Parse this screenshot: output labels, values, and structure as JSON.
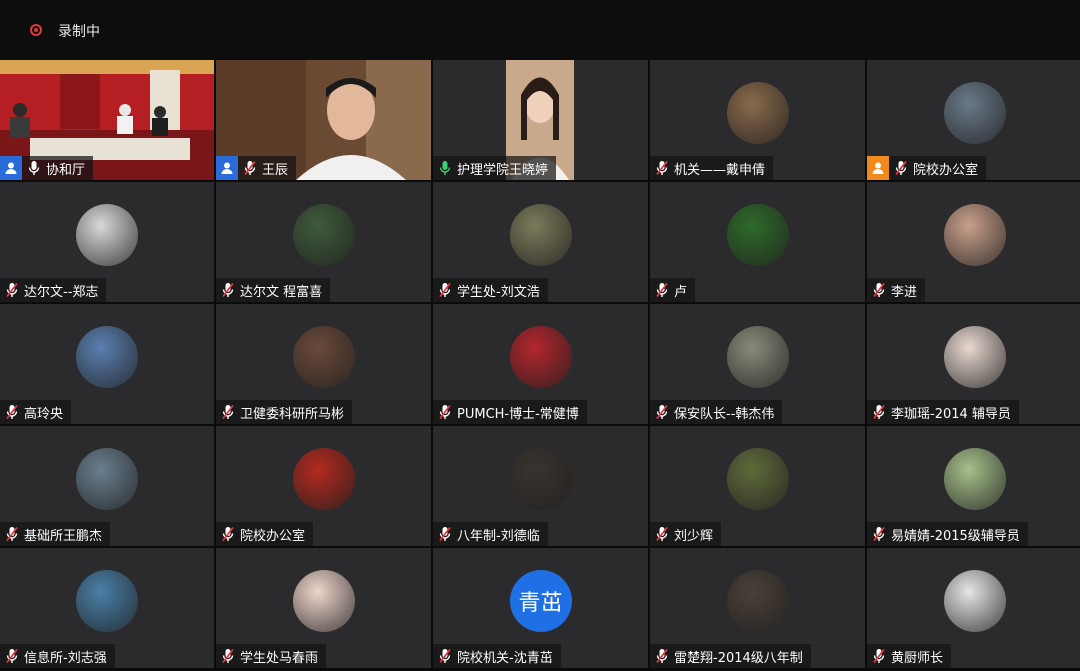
{
  "topbar": {
    "recording_label": "录制中"
  },
  "tiles": [
    {
      "name": "协和厅",
      "badge": "blue",
      "mic": "on",
      "kind": "video",
      "scene": "room"
    },
    {
      "name": "王辰",
      "badge": "blue",
      "mic": "muted",
      "kind": "video",
      "scene": "man"
    },
    {
      "name": "护理学院王晓婷",
      "badge": "",
      "mic": "active",
      "kind": "video",
      "scene": "girl",
      "active": true
    },
    {
      "name": "机关——戴申倩",
      "badge": "",
      "mic": "muted",
      "kind": "avatar",
      "color": "#8a6a4a"
    },
    {
      "name": "院校办公室",
      "badge": "orange",
      "mic": "muted",
      "kind": "avatar",
      "color": "#6a7a8a"
    },
    {
      "name": "达尔文--郑志",
      "badge": "",
      "mic": "muted",
      "kind": "avatar",
      "color": "#d9d9d9"
    },
    {
      "name": "达尔文  程富喜",
      "badge": "",
      "mic": "muted",
      "kind": "avatar",
      "color": "#3f5b3b"
    },
    {
      "name": "学生处-刘文浩",
      "badge": "",
      "mic": "muted",
      "kind": "avatar",
      "color": "#7c7a5a"
    },
    {
      "name": "卢",
      "badge": "",
      "mic": "muted",
      "kind": "avatar",
      "color": "#2f6b2a"
    },
    {
      "name": "李进",
      "badge": "",
      "mic": "muted",
      "kind": "avatar",
      "color": "#c9a08a"
    },
    {
      "name": "高玲央",
      "badge": "",
      "mic": "muted",
      "kind": "avatar",
      "color": "#5a7fb0"
    },
    {
      "name": "卫健委科研所马彬",
      "badge": "",
      "mic": "muted",
      "kind": "avatar",
      "color": "#6b4a3a"
    },
    {
      "name": "PUMCH-博士-常健博",
      "badge": "",
      "mic": "muted",
      "kind": "avatar",
      "color": "#b3262d"
    },
    {
      "name": "保安队长--韩杰伟",
      "badge": "",
      "mic": "muted",
      "kind": "avatar",
      "color": "#8a8a7a"
    },
    {
      "name": "李珈瑶-2014 辅导员",
      "badge": "",
      "mic": "muted",
      "kind": "avatar",
      "color": "#e8d9cf"
    },
    {
      "name": "基础所王鹏杰",
      "badge": "",
      "mic": "muted",
      "kind": "avatar",
      "color": "#6a7f8f"
    },
    {
      "name": "院校办公室",
      "badge": "",
      "mic": "muted",
      "kind": "avatar",
      "color": "#b32a1f"
    },
    {
      "name": "八年制-刘德临",
      "badge": "",
      "mic": "muted",
      "kind": "avatar",
      "color": "#3a3430"
    },
    {
      "name": "刘少辉",
      "badge": "",
      "mic": "muted",
      "kind": "avatar",
      "color": "#5f6b3a"
    },
    {
      "name": "易婧婧-2015级辅导员",
      "badge": "",
      "mic": "muted",
      "kind": "avatar",
      "color": "#a7c08a"
    },
    {
      "name": "信息所-刘志强",
      "badge": "",
      "mic": "muted",
      "kind": "avatar",
      "color": "#4a7fa8"
    },
    {
      "name": "学生处马春雨",
      "badge": "",
      "mic": "muted",
      "kind": "avatar",
      "color": "#f0d6cc"
    },
    {
      "name": "院校机关-沈青茁",
      "badge": "",
      "mic": "muted",
      "kind": "text",
      "avatar_text": "青茁"
    },
    {
      "name": "雷楚翔-2014级八年制",
      "badge": "",
      "mic": "muted",
      "kind": "avatar",
      "color": "#4a4038"
    },
    {
      "name": "黄厨师长",
      "badge": "",
      "mic": "muted",
      "kind": "avatar",
      "color": "#e6e6e6"
    }
  ]
}
